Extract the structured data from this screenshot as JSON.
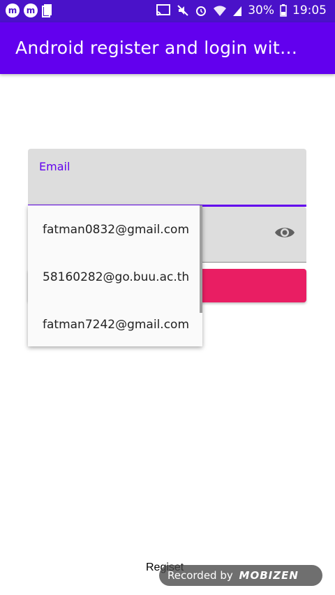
{
  "status_bar": {
    "battery": "30%",
    "time": "19:05",
    "left_icons": [
      "m",
      "m"
    ],
    "right_icons": [
      "cast-icon",
      "mute-icon",
      "alarm-icon",
      "wifi-icon",
      "signal-icon",
      "battery-icon"
    ]
  },
  "app_bar": {
    "title": "Android register and login with…",
    "color": "#6200ee"
  },
  "form": {
    "email_label": "Email",
    "email_value": "",
    "password_value": "",
    "login_button_color": "#e91e63"
  },
  "dropdown": {
    "items": [
      "fatman0832@gmail.com",
      "58160282@go.buu.ac.th",
      "fatman7242@gmail.com"
    ]
  },
  "register_link": "Regiset",
  "watermark": {
    "prefix": "Recorded by",
    "logo": "MOBIZEN"
  }
}
